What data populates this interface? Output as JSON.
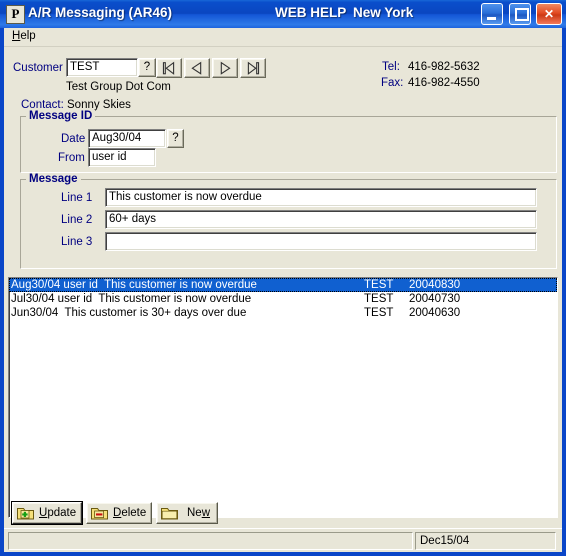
{
  "window": {
    "icon_letter": "P",
    "title": "A/R Messaging (AR46)",
    "web_help": "WEB HELP",
    "region": "New York",
    "minimize_tip": "Minimize",
    "maximize_tip": "Maximize",
    "close_tip": "Close",
    "frame_color": "#0a46c8",
    "titlebar_color": "#0a46c0",
    "client_color": "#e8e6d8"
  },
  "menu": {
    "help": "Help"
  },
  "customer": {
    "label": "Customer",
    "value": "TEST",
    "lookup_button": "?",
    "name": "Test Group Dot Com",
    "contact_label": "Contact:",
    "contact_value": "Sonny Skies",
    "nav": {
      "first": "first-record",
      "prev": "previous-record",
      "next": "next-record",
      "last": "last-record"
    }
  },
  "contact_info": {
    "tel_label": "Tel:",
    "tel_value": "416-982-5632",
    "fax_label": "Fax:",
    "fax_value": "416-982-4550"
  },
  "message_id": {
    "group_title": "Message ID",
    "date_label": "Date",
    "date_value": "Aug30/04",
    "date_lookup": "?",
    "from_label": "From",
    "from_value": "user id"
  },
  "message": {
    "group_title": "Message",
    "line1_label": "Line 1",
    "line1_value": "This customer is now overdue",
    "line2_label": "Line 2",
    "line2_value": "60+ days",
    "line3_label": "Line 3",
    "line3_value": ""
  },
  "list": {
    "rows": [
      {
        "text": "Aug30/04 user id  This customer is now overdue",
        "customer": "TEST",
        "key": "20040830",
        "selected": true
      },
      {
        "text": "Jul30/04 user id  This customer is now overdue",
        "customer": "TEST",
        "key": "20040730",
        "selected": false
      },
      {
        "text": "Jun30/04  This customer is 30+ days over due",
        "customer": "TEST",
        "key": "20040630",
        "selected": false
      }
    ],
    "selection_color": "#1060d0"
  },
  "actions": {
    "update": "Update",
    "update_accel": "U",
    "delete": "Delete",
    "delete_accel": "D",
    "new": "New",
    "new_accel": "w"
  },
  "statusbar": {
    "left_text": "",
    "date": "Dec15/04"
  }
}
